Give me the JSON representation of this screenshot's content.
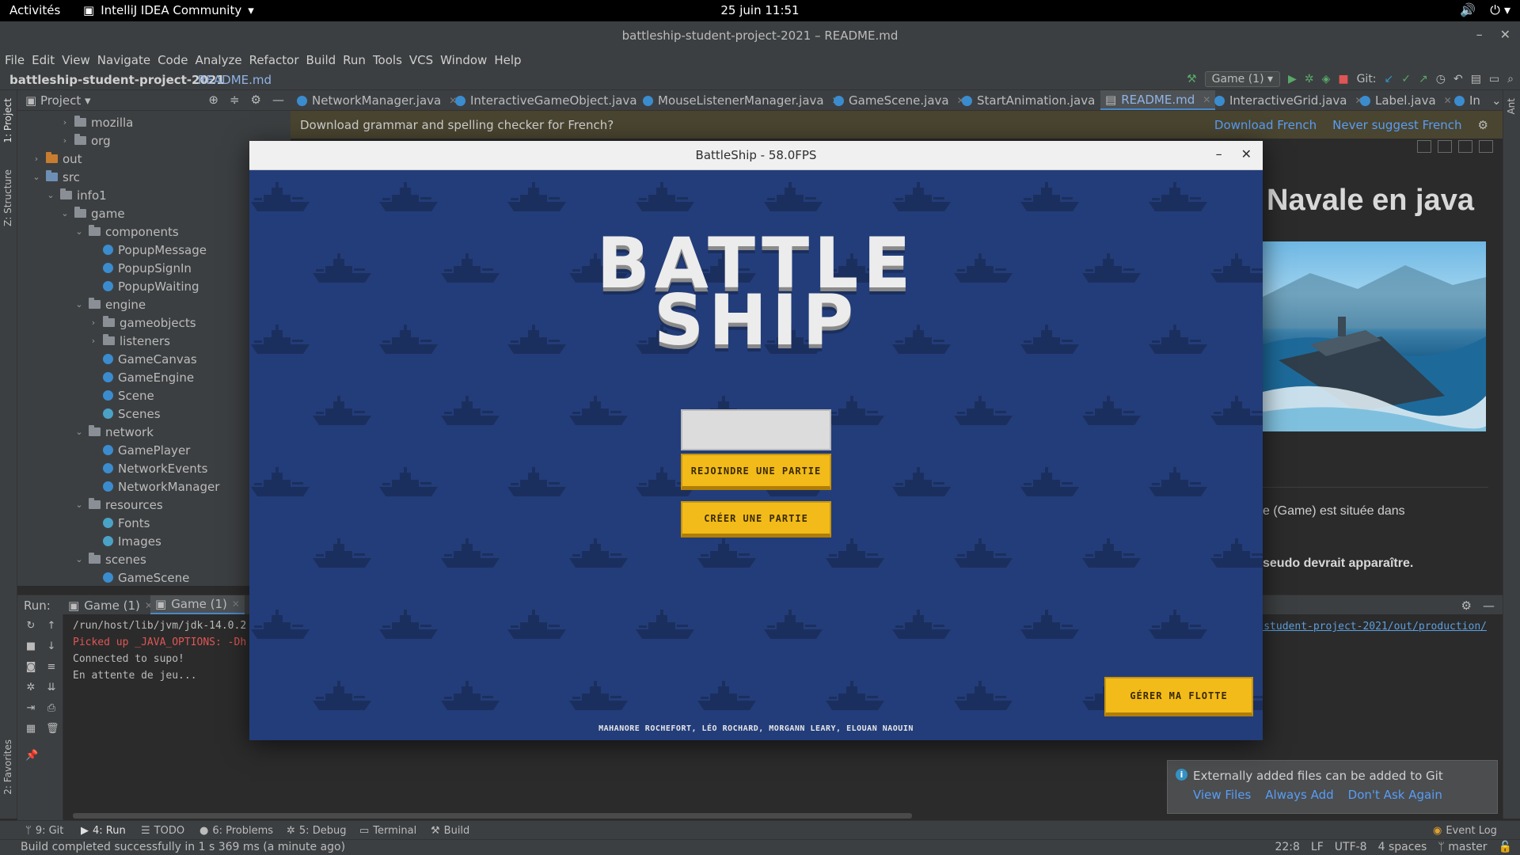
{
  "gnome": {
    "activities": "Activités",
    "app_name": "IntelliJ IDEA Community",
    "clock": "25 juin  11:51"
  },
  "window": {
    "title": "battleship-student-project-2021 – README.md"
  },
  "menu": [
    "File",
    "Edit",
    "View",
    "Navigate",
    "Code",
    "Analyze",
    "Refactor",
    "Build",
    "Run",
    "Tools",
    "VCS",
    "Window",
    "Help"
  ],
  "nav": {
    "project": "battleship-student-project-2021",
    "file": "README.md",
    "run_config": "Game (1)",
    "git_label": "Git:"
  },
  "project_panel": {
    "title": "Project",
    "tree": [
      {
        "label": "mozilla",
        "kind": "folder",
        "depth": 3,
        "arrow": "›"
      },
      {
        "label": "org",
        "kind": "folder",
        "depth": 3,
        "arrow": "›"
      },
      {
        "label": "out",
        "kind": "folder-orange",
        "depth": 1,
        "arrow": "›"
      },
      {
        "label": "src",
        "kind": "folder-blue",
        "depth": 1,
        "arrow": "⌄"
      },
      {
        "label": "info1",
        "kind": "folder",
        "depth": 2,
        "arrow": "⌄"
      },
      {
        "label": "game",
        "kind": "folder",
        "depth": 3,
        "arrow": "⌄"
      },
      {
        "label": "components",
        "kind": "folder",
        "depth": 4,
        "arrow": "⌄"
      },
      {
        "label": "PopupMessage",
        "kind": "class",
        "depth": 5,
        "arrow": ""
      },
      {
        "label": "PopupSignIn",
        "kind": "class",
        "depth": 5,
        "arrow": ""
      },
      {
        "label": "PopupWaiting",
        "kind": "class",
        "depth": 5,
        "arrow": ""
      },
      {
        "label": "engine",
        "kind": "folder",
        "depth": 4,
        "arrow": "⌄"
      },
      {
        "label": "gameobjects",
        "kind": "folder",
        "depth": 5,
        "arrow": "›"
      },
      {
        "label": "listeners",
        "kind": "folder",
        "depth": 5,
        "arrow": "›"
      },
      {
        "label": "GameCanvas",
        "kind": "class",
        "depth": 5,
        "arrow": ""
      },
      {
        "label": "GameEngine",
        "kind": "class",
        "depth": 5,
        "arrow": ""
      },
      {
        "label": "Scene",
        "kind": "class",
        "depth": 5,
        "arrow": ""
      },
      {
        "label": "Scenes",
        "kind": "class-res",
        "depth": 5,
        "arrow": ""
      },
      {
        "label": "network",
        "kind": "folder",
        "depth": 4,
        "arrow": "⌄"
      },
      {
        "label": "GamePlayer",
        "kind": "class",
        "depth": 5,
        "arrow": ""
      },
      {
        "label": "NetworkEvents",
        "kind": "class",
        "depth": 5,
        "arrow": ""
      },
      {
        "label": "NetworkManager",
        "kind": "class",
        "depth": 5,
        "arrow": ""
      },
      {
        "label": "resources",
        "kind": "folder",
        "depth": 4,
        "arrow": "⌄"
      },
      {
        "label": "Fonts",
        "kind": "class-res",
        "depth": 5,
        "arrow": ""
      },
      {
        "label": "Images",
        "kind": "class-res",
        "depth": 5,
        "arrow": ""
      },
      {
        "label": "scenes",
        "kind": "folder",
        "depth": 4,
        "arrow": "⌄"
      },
      {
        "label": "GameScene",
        "kind": "class",
        "depth": 5,
        "arrow": ""
      }
    ]
  },
  "editor_tabs": [
    {
      "label": "NetworkManager.java",
      "active": false
    },
    {
      "label": "InteractiveGameObject.java",
      "active": false
    },
    {
      "label": "MouseListenerManager.java",
      "active": false
    },
    {
      "label": "GameScene.java",
      "active": false
    },
    {
      "label": "StartAnimation.java",
      "active": false
    },
    {
      "label": "README.md",
      "active": true
    },
    {
      "label": "InteractiveGrid.java",
      "active": false
    },
    {
      "label": "Label.java",
      "active": false
    },
    {
      "label": "In",
      "active": false
    }
  ],
  "notification": {
    "message": "Download grammar and spelling checker for French?",
    "download": "Download French",
    "never": "Never suggest French"
  },
  "preview": {
    "heading": "Navale en java",
    "text1": "e (Game) est située dans",
    "text2": "seudo devrait apparaître."
  },
  "run": {
    "label": "Run:",
    "tabs": [
      {
        "label": "Game (1)",
        "active": false
      },
      {
        "label": "Game (1)",
        "active": true
      }
    ],
    "console": [
      {
        "text": "/run/host/lib/jvm/jdk-14.0.2",
        "type": "normal"
      },
      {
        "text": "Picked up _JAVA_OPTIONS: -Dh",
        "type": "err"
      },
      {
        "text": "Connected to supo!",
        "type": "normal"
      },
      {
        "text": "En attente de jeu...",
        "type": "normal"
      }
    ],
    "path_link": "p-student-project-2021/out/production/"
  },
  "game": {
    "title": "BattleShip - 58.0FPS",
    "logo_line1": "BATTLE",
    "logo_line2": "SHIP",
    "join_label": "REJOINDRE UNE PARTIE",
    "create_label": "CRÉER UNE PARTIE",
    "fleet_label": "GÉRER MA FLOTTE",
    "credits": "MAHANORE ROCHEFORT, LÉO ROCHARD, MORGANN LEARY, ELOUAN NAOUIN",
    "input_value": "",
    "colors": {
      "background": "#233d7a",
      "ship": "#1b2f5e",
      "button": "#f2bb19"
    }
  },
  "toolwindows": [
    {
      "label": "9: Git",
      "active": false
    },
    {
      "label": "4: Run",
      "active": true
    },
    {
      "label": "TODO",
      "active": false
    },
    {
      "label": "6: Problems",
      "active": false
    },
    {
      "label": "5: Debug",
      "active": false
    },
    {
      "label": "Terminal",
      "active": false
    },
    {
      "label": "Build",
      "active": false
    }
  ],
  "event_log": "Event Log",
  "balloon": {
    "message": "Externally added files can be added to Git",
    "view": "View Files",
    "always": "Always Add",
    "dont": "Don't Ask Again"
  },
  "status": {
    "message": "Build completed successfully in 1 s 369 ms (a minute ago)",
    "position": "22:8",
    "line_sep": "LF",
    "encoding": "UTF-8",
    "indent": "4 spaces",
    "branch": "master"
  },
  "side_tabs": {
    "project": "1: Project",
    "structure": "Z: Structure",
    "favorites": "2: Favorites",
    "ant": "Ant"
  }
}
